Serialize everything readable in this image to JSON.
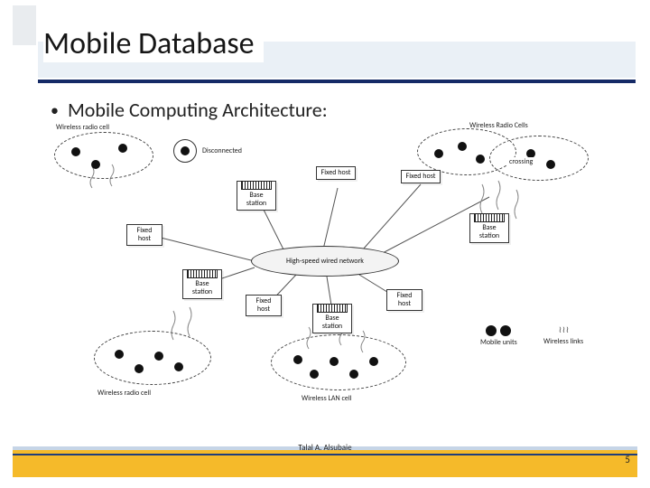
{
  "title": "Mobile Database",
  "bullet": "Mobile Computing Architecture:",
  "diagram": {
    "labels": {
      "cell_tl": "Wireless radio cell",
      "disconnected": "Disconnected",
      "cell_tr": "Wireless Radio Cells",
      "crossing": "crossing",
      "fixed_host": "Fixed\nhost",
      "base_station": "Base\nstation",
      "hub": "High-speed wired network",
      "wlan_cell": "Wireless LAN cell",
      "cell_bl": "Wireless radio cell",
      "legend_units": "Mobile\nunits",
      "legend_links": "Wireless\nlinks"
    }
  },
  "footer": {
    "author": "Talal A. Alsubaie",
    "page": "5"
  }
}
